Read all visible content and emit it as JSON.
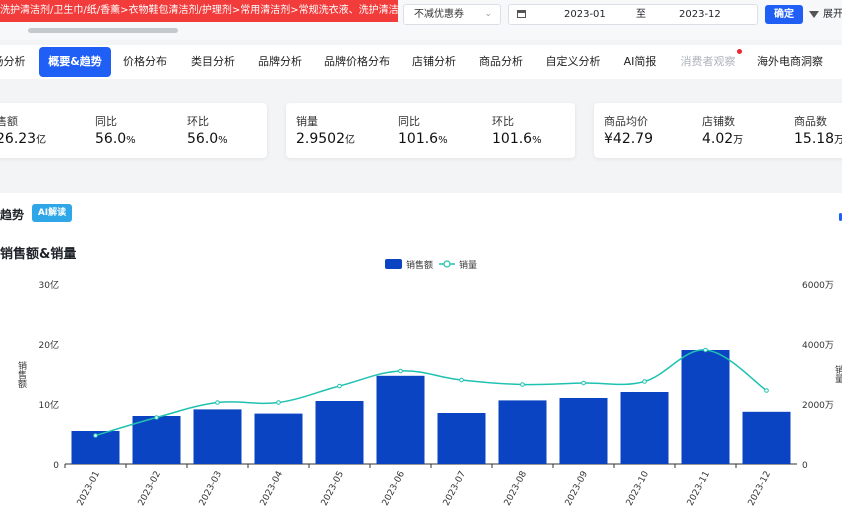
{
  "breadcrumb": {
    "text": "洗护清洁剂/卫生巾/纸/香薰>衣物鞋包清洁剂/护理剂>常用清洁剂>常规洗衣液、洗护清洁剂/卫生巾/纸/香薰>衣"
  },
  "filters": {
    "discount": "不减优惠券",
    "date_start": "2023-01",
    "date_to": "至",
    "date_end": "2023-12",
    "confirm": "确定",
    "expand": "展开"
  },
  "tabs": [
    {
      "label": "场分析",
      "state": "normal"
    },
    {
      "label": "概要&趋势",
      "state": "active"
    },
    {
      "label": "价格分布",
      "state": "normal"
    },
    {
      "label": "类目分析",
      "state": "normal"
    },
    {
      "label": "品牌分析",
      "state": "normal"
    },
    {
      "label": "品牌价格分布",
      "state": "normal"
    },
    {
      "label": "店铺分析",
      "state": "normal"
    },
    {
      "label": "商品分析",
      "state": "normal"
    },
    {
      "label": "自定义分析",
      "state": "normal"
    },
    {
      "label": "AI简报",
      "state": "normal"
    },
    {
      "label": "消费者观察",
      "state": "muted"
    },
    {
      "label": "海外电商洞察",
      "state": "normal"
    }
  ],
  "metrics": {
    "sales": {
      "label": "售额",
      "value": "26.23",
      "unit": "亿"
    },
    "sales_yoy": {
      "label": "同比",
      "value": "56.0",
      "unit": "%"
    },
    "sales_mom": {
      "label": "环比",
      "value": "56.0",
      "unit": "%"
    },
    "volume": {
      "label": "销量",
      "value": "2.9502",
      "unit": "亿"
    },
    "volume_yoy": {
      "label": "同比",
      "value": "101.6",
      "unit": "%"
    },
    "volume_mom": {
      "label": "环比",
      "value": "101.6",
      "unit": "%"
    },
    "avg_price": {
      "label": "商品均价",
      "value": "¥42.79",
      "unit": ""
    },
    "stores": {
      "label": "店铺数",
      "value": "4.02",
      "unit": "万"
    },
    "products": {
      "label": "商品数",
      "value": "15.18",
      "unit": "万"
    }
  },
  "section": {
    "title": "趋势",
    "ai_tag": "AI解读"
  },
  "chart_data": {
    "type": "bar",
    "title": "销售额&销量",
    "categories": [
      "2023-01",
      "2023-02",
      "2023-03",
      "2023-04",
      "2023-05",
      "2023-06",
      "2023-07",
      "2023-08",
      "2023-09",
      "2023-10",
      "2023-11",
      "2023-12"
    ],
    "series": [
      {
        "name": "销售额",
        "type": "bar",
        "axis": "left",
        "color": "#0a44c2",
        "values": [
          5.5,
          8.0,
          9.1,
          8.4,
          10.5,
          14.7,
          8.5,
          10.6,
          11.0,
          12.0,
          19.0,
          8.7
        ]
      },
      {
        "name": "销量",
        "type": "line",
        "axis": "right",
        "color": "#1fc2b0",
        "values": [
          950,
          1550,
          2050,
          2050,
          2600,
          3100,
          2800,
          2650,
          2700,
          2750,
          3800,
          2450
        ]
      }
    ],
    "ylabel": "销售额",
    "y2label": "销量",
    "ylim": [
      0,
      30
    ],
    "y2lim": [
      0,
      6000
    ],
    "yticks": [
      "0",
      "10亿",
      "20亿",
      "30亿"
    ],
    "y2ticks": [
      "0",
      "2000万",
      "4000万",
      "6000万"
    ],
    "legend": "top-center"
  }
}
